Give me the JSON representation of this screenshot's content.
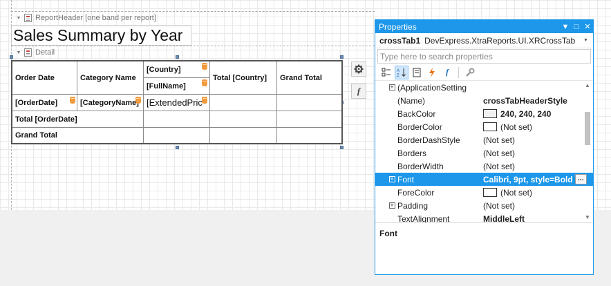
{
  "designer": {
    "report_header_band": "ReportHeader [one band per report]",
    "detail_band": "Detail",
    "report_title": "Sales Summary by Year"
  },
  "crosstab": {
    "order_date_header": "Order Date",
    "category_header": "Category Name",
    "country_field": "[Country]",
    "fullname_field": "[FullName]",
    "total_country": "Total [Country]",
    "grand_total_header": "Grand Total",
    "orderdate_field": "[OrderDate]",
    "categoryname_field": "[CategoryName]",
    "extended_price_field": "[ExtendedPric",
    "total_orderdate": "Total [OrderDate]",
    "grand_total_row": "Grand Total"
  },
  "side_buttons": {
    "settings_icon": "gear-icon",
    "expression_label": "f"
  },
  "properties": {
    "title": "Properties",
    "object_name": "crossTab1",
    "object_type": "DevExpress.XtraReports.UI.XRCrossTab",
    "search_placeholder": "Type here to search properties",
    "rows": [
      {
        "name": "(ApplicationSetting",
        "value": "",
        "expandable": true
      },
      {
        "name": "(Name)",
        "value": "crossTabHeaderStyle",
        "bold": true
      },
      {
        "name": "BackColor",
        "value": "240, 240, 240",
        "bold": true,
        "swatch": "#f0f0f0"
      },
      {
        "name": "BorderColor",
        "value": "(Not set)",
        "swatch": "#ffffff"
      },
      {
        "name": "BorderDashStyle",
        "value": "(Not set)"
      },
      {
        "name": "Borders",
        "value": "(Not set)"
      },
      {
        "name": "BorderWidth",
        "value": "(Not set)"
      },
      {
        "name": "Font",
        "value": "Calibri, 9pt, style=Bold",
        "bold": true,
        "expandable": true,
        "selected": true,
        "ellipsis": "..."
      },
      {
        "name": "ForeColor",
        "value": "(Not set)",
        "swatch": "#ffffff"
      },
      {
        "name": "Padding",
        "value": "(Not set)",
        "expandable": true
      },
      {
        "name": "TextAlignment",
        "value": "MiddleLeft",
        "bold": true
      }
    ],
    "description_title": "Font"
  },
  "colors": {
    "accent": "#1c97ea",
    "smart_tag": "#f19a3e",
    "grid_line": "#e9e9e9"
  }
}
